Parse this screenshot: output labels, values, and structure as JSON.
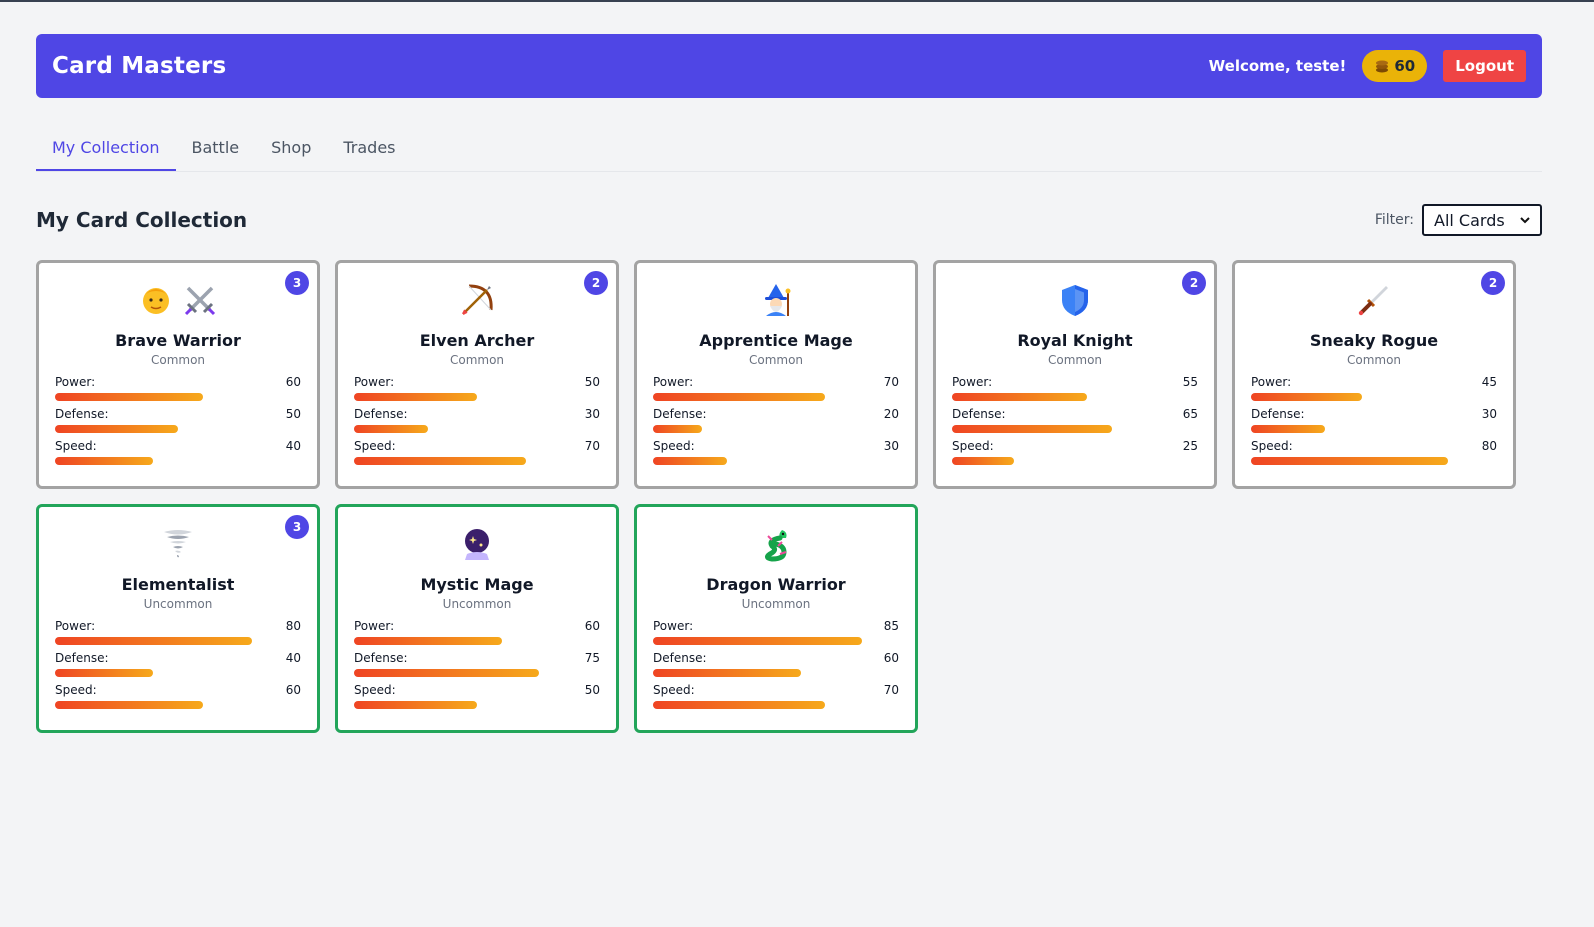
{
  "header": {
    "title": "Card Masters",
    "welcome": "Welcome, teste!",
    "coins": "60",
    "logout_label": "Logout"
  },
  "tabs": [
    {
      "label": "My Collection",
      "active": true
    },
    {
      "label": "Battle",
      "active": false
    },
    {
      "label": "Shop",
      "active": false
    },
    {
      "label": "Trades",
      "active": false
    }
  ],
  "collection": {
    "title": "My Card Collection",
    "filter_label": "Filter:",
    "filter_value": "All Cards"
  },
  "stat_labels": {
    "power": "Power:",
    "defense": "Defense:",
    "speed": "Speed:"
  },
  "stat_max": 100,
  "colors": {
    "brand": "#4f46e5",
    "coins": "#eab308",
    "logout": "#ef4444",
    "common_border": "#a3a3a3",
    "uncommon_border": "#22a55a"
  },
  "cards": [
    {
      "name": "Brave Warrior",
      "rarity": "Common",
      "count": "3",
      "icons": [
        "man-face-icon",
        "crossed-swords-icon"
      ],
      "power": 60,
      "defense": 50,
      "speed": 40
    },
    {
      "name": "Elven Archer",
      "rarity": "Common",
      "count": "2",
      "icons": [
        "bow-arrow-icon"
      ],
      "power": 50,
      "defense": 30,
      "speed": 70
    },
    {
      "name": "Apprentice Mage",
      "rarity": "Common",
      "count": "",
      "icons": [
        "wizard-icon"
      ],
      "power": 70,
      "defense": 20,
      "speed": 30
    },
    {
      "name": "Royal Knight",
      "rarity": "Common",
      "count": "2",
      "icons": [
        "shield-icon"
      ],
      "power": 55,
      "defense": 65,
      "speed": 25
    },
    {
      "name": "Sneaky Rogue",
      "rarity": "Common",
      "count": "2",
      "icons": [
        "dagger-icon"
      ],
      "power": 45,
      "defense": 30,
      "speed": 80
    },
    {
      "name": "Elementalist",
      "rarity": "Uncommon",
      "count": "3",
      "icons": [
        "tornado-icon"
      ],
      "power": 80,
      "defense": 40,
      "speed": 60
    },
    {
      "name": "Mystic Mage",
      "rarity": "Uncommon",
      "count": "",
      "icons": [
        "crystal-ball-icon"
      ],
      "power": 60,
      "defense": 75,
      "speed": 50
    },
    {
      "name": "Dragon Warrior",
      "rarity": "Uncommon",
      "count": "",
      "icons": [
        "dragon-icon"
      ],
      "power": 85,
      "defense": 60,
      "speed": 70
    }
  ]
}
